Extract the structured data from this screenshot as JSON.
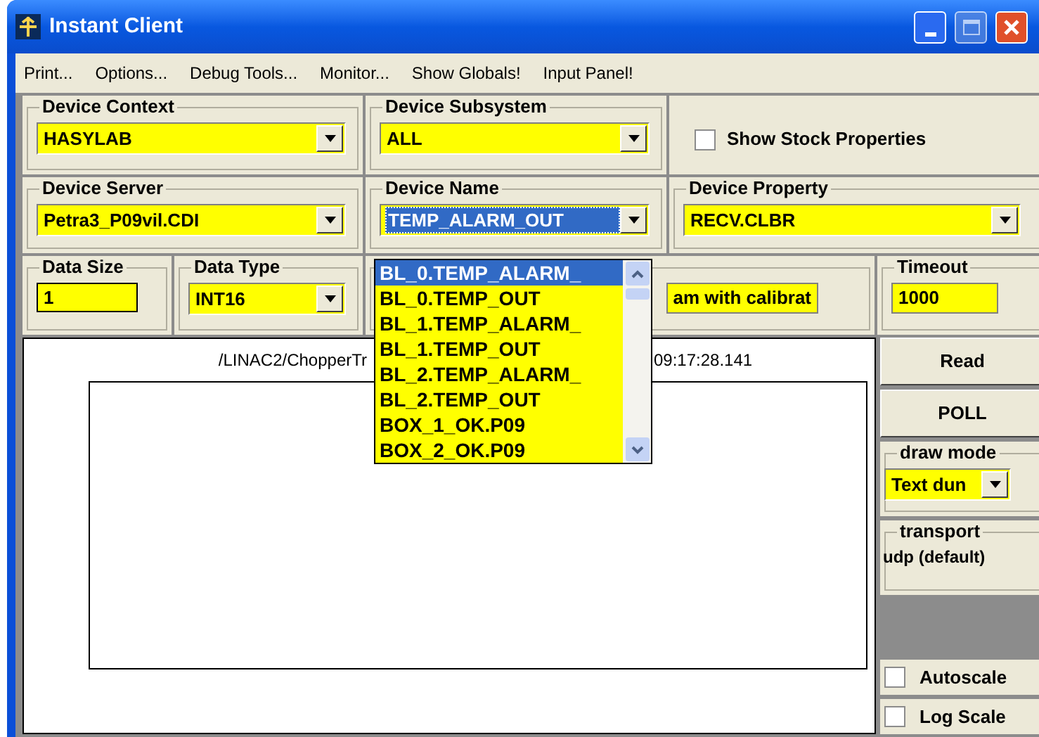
{
  "window": {
    "title": "Instant Client"
  },
  "menu": [
    {
      "label": "Print..."
    },
    {
      "label": "Options..."
    },
    {
      "label": "Debug Tools..."
    },
    {
      "label": "Monitor..."
    },
    {
      "label": "Show Globals!"
    },
    {
      "label": "Input Panel!"
    }
  ],
  "device_context": {
    "label": "Device Context",
    "value": "HASYLAB"
  },
  "device_subsystem": {
    "label": "Device Subsystem",
    "value": "ALL"
  },
  "show_stock_properties": {
    "label": "Show Stock Properties",
    "checked": false
  },
  "device_server": {
    "label": "Device Server",
    "value": "Petra3_P09vil.CDI"
  },
  "device_name": {
    "label": "Device Name",
    "value": "TEMP_ALARM_OUT",
    "value_selected": true
  },
  "device_property": {
    "label": "Device Property",
    "value": "RECV.CLBR"
  },
  "data_size": {
    "label": "Data Size",
    "value": "1"
  },
  "data_type": {
    "label": "Data Type",
    "value": "INT16"
  },
  "property_description": {
    "value": "am with calibrat"
  },
  "timeout": {
    "label": "Timeout",
    "value": "1000"
  },
  "plot": {
    "title_left": "/LINAC2/ChopperTr",
    "title_right": "09:17:28.141"
  },
  "buttons": [
    {
      "label": "Read"
    },
    {
      "label": "POLL"
    }
  ],
  "draw_mode": {
    "label": "draw mode",
    "value": "Text dun"
  },
  "transport": {
    "label": "transport",
    "value": "udp (default)"
  },
  "checkboxes": [
    {
      "label": "Autoscale",
      "checked": false
    },
    {
      "label": "Log Scale",
      "checked": false
    }
  ],
  "device_name_list": [
    {
      "label": "BL_0.TEMP_ALARM_",
      "selected": true
    },
    {
      "label": "BL_0.TEMP_OUT",
      "selected": false
    },
    {
      "label": "BL_1.TEMP_ALARM_",
      "selected": false
    },
    {
      "label": "BL_1.TEMP_OUT",
      "selected": false
    },
    {
      "label": "BL_2.TEMP_ALARM_",
      "selected": false
    },
    {
      "label": "BL_2.TEMP_OUT",
      "selected": false
    },
    {
      "label": "BOX_1_OK.P09",
      "selected": false
    },
    {
      "label": "BOX_2_OK.P09",
      "selected": false
    }
  ]
}
